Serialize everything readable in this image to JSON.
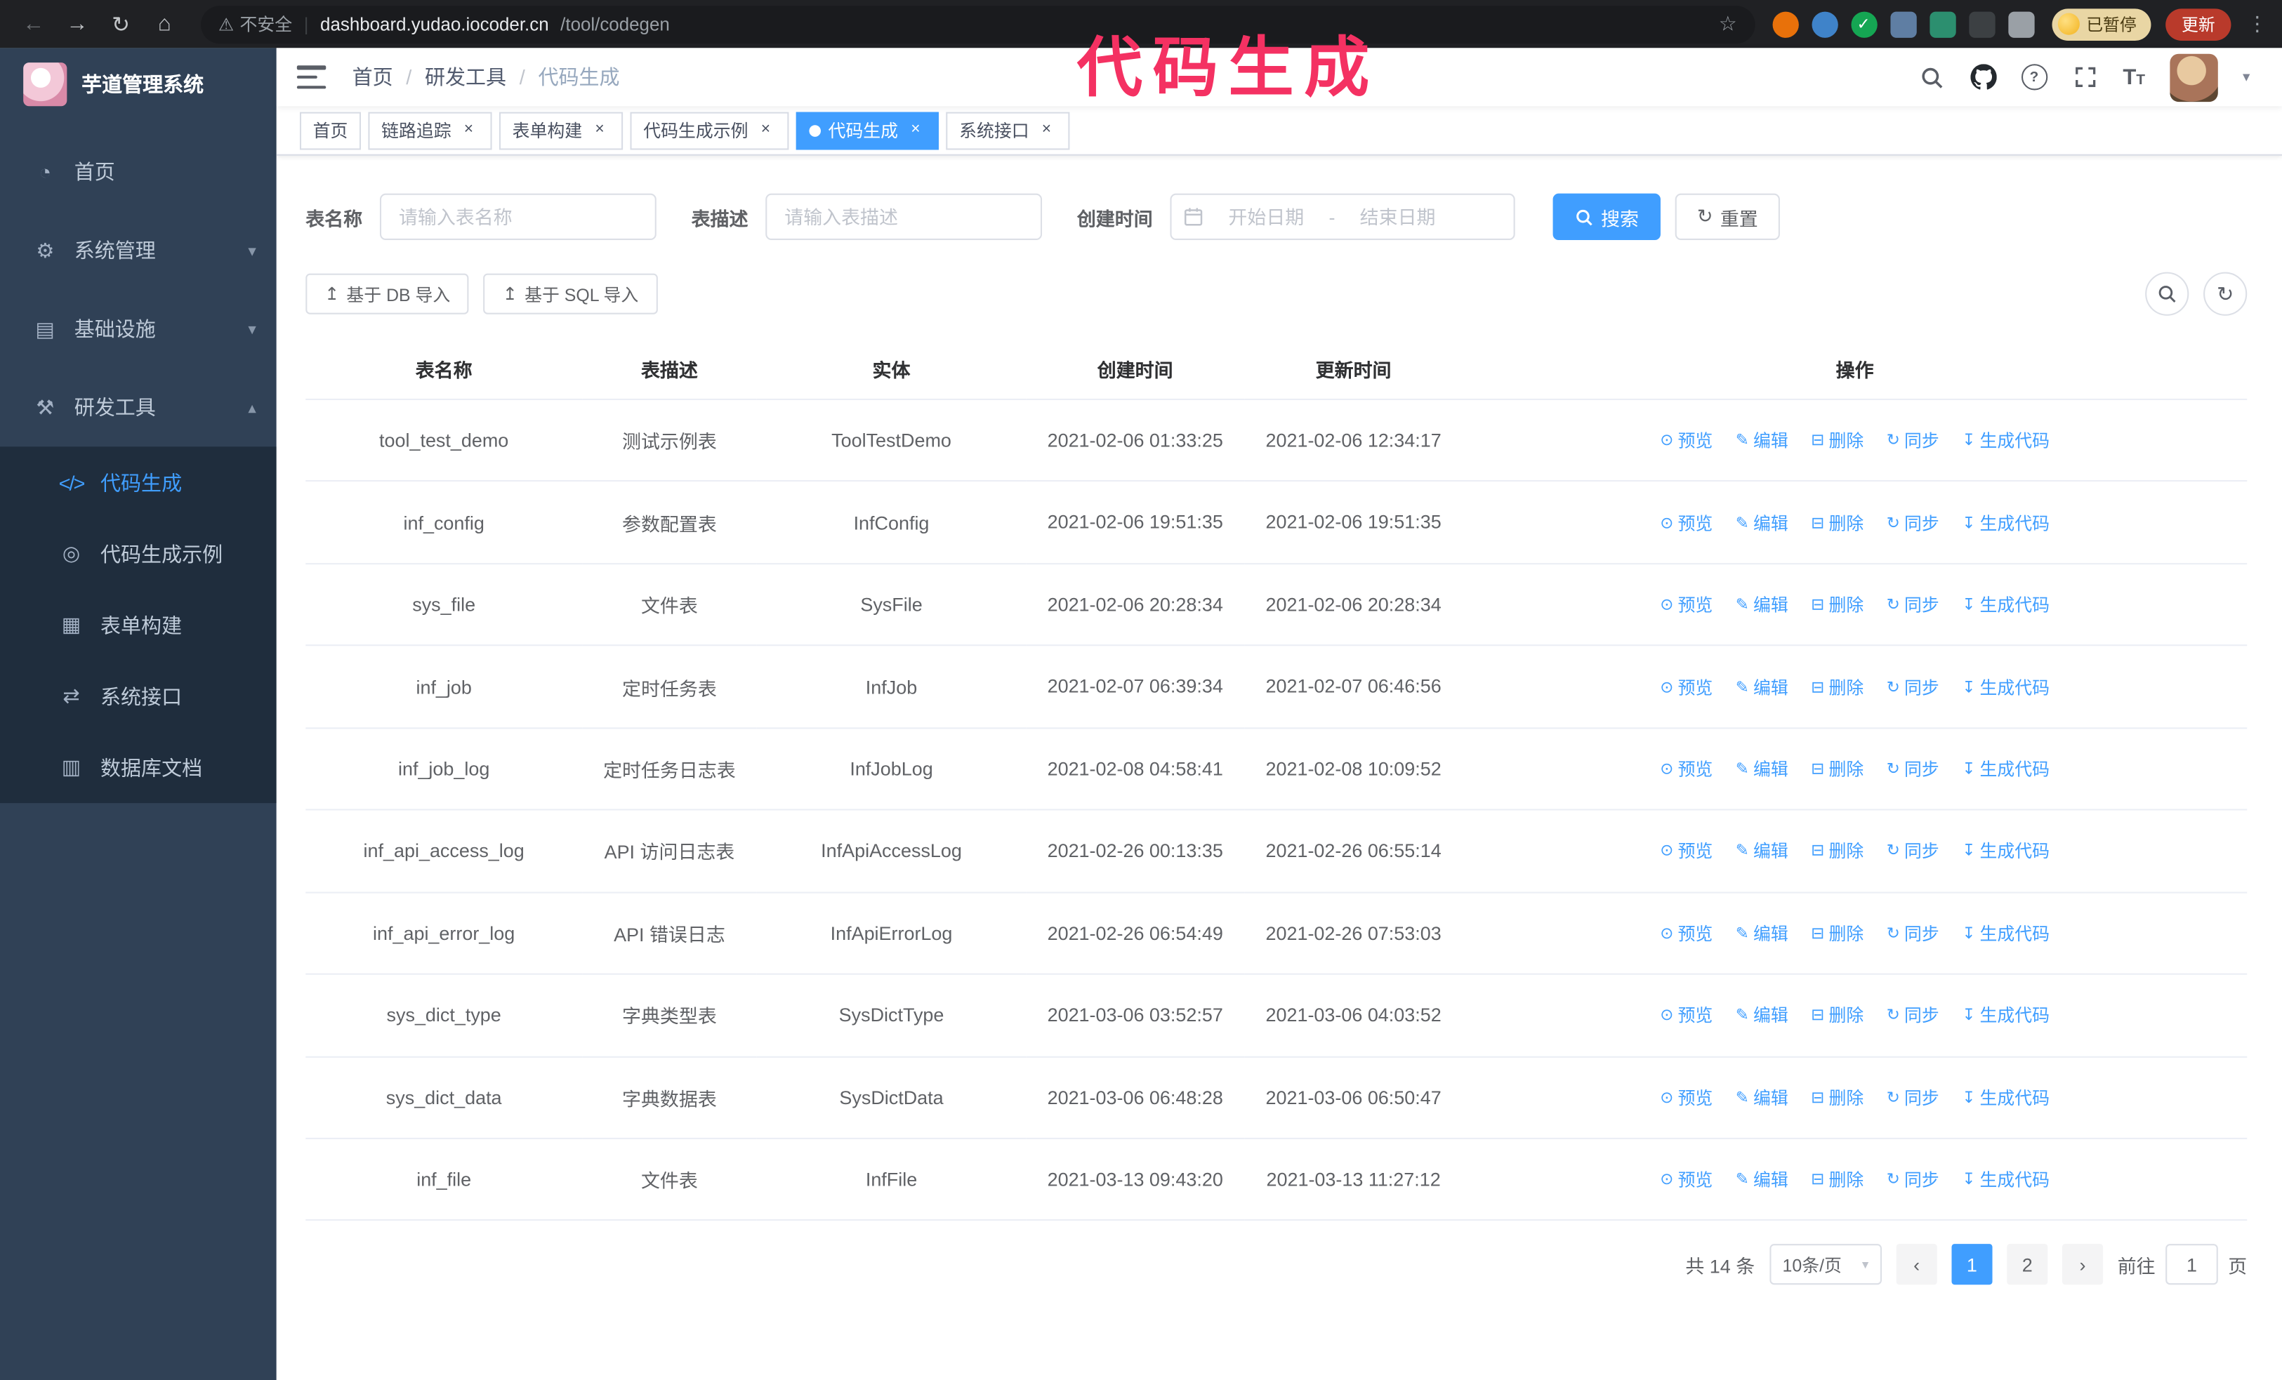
{
  "annotation": "代码生成",
  "colors": {
    "accent": "#409EFF",
    "annotation": "#f43162"
  },
  "browser": {
    "security_label": "不安全",
    "url_host": "dashboard.yudao.iocoder.cn",
    "url_path": "/tool/codegen",
    "paused_badge": "已暂停",
    "update_button": "更新"
  },
  "sidebar": {
    "logo_title": "芋道管理系统",
    "items": [
      {
        "label": "首页"
      },
      {
        "label": "系统管理"
      },
      {
        "label": "基础设施"
      },
      {
        "label": "研发工具"
      }
    ],
    "sub_items": [
      {
        "label": "代码生成"
      },
      {
        "label": "代码生成示例"
      },
      {
        "label": "表单构建"
      },
      {
        "label": "系统接口"
      },
      {
        "label": "数据库文档"
      }
    ]
  },
  "header": {
    "breadcrumb": [
      "首页",
      "研发工具",
      "代码生成"
    ],
    "separator": "/"
  },
  "tabs": [
    {
      "label": "首页"
    },
    {
      "label": "链路追踪"
    },
    {
      "label": "表单构建"
    },
    {
      "label": "代码生成示例"
    },
    {
      "label": "代码生成"
    },
    {
      "label": "系统接口"
    }
  ],
  "filters": {
    "table_name_label": "表名称",
    "table_name_placeholder": "请输入表名称",
    "table_desc_label": "表描述",
    "table_desc_placeholder": "请输入表描述",
    "create_time_label": "创建时间",
    "date_start_placeholder": "开始日期",
    "date_separator": "-",
    "date_end_placeholder": "结束日期",
    "search_button": "搜索",
    "reset_button": "重置"
  },
  "toolbar": {
    "import_db": "基于 DB 导入",
    "import_sql": "基于 SQL 导入"
  },
  "table": {
    "columns": [
      "表名称",
      "表描述",
      "实体",
      "创建时间",
      "更新时间",
      "操作"
    ],
    "actions": [
      "预览",
      "编辑",
      "删除",
      "同步",
      "生成代码"
    ],
    "rows": [
      {
        "name": "tool_test_demo",
        "desc": "测试示例表",
        "entity": "ToolTestDemo",
        "created": "2021-02-06 01:33:25",
        "updated": "2021-02-06 12:34:17"
      },
      {
        "name": "inf_config",
        "desc": "参数配置表",
        "entity": "InfConfig",
        "created": "2021-02-06 19:51:35",
        "updated": "2021-02-06 19:51:35"
      },
      {
        "name": "sys_file",
        "desc": "文件表",
        "entity": "SysFile",
        "created": "2021-02-06 20:28:34",
        "updated": "2021-02-06 20:28:34"
      },
      {
        "name": "inf_job",
        "desc": "定时任务表",
        "entity": "InfJob",
        "created": "2021-02-07 06:39:34",
        "updated": "2021-02-07 06:46:56"
      },
      {
        "name": "inf_job_log",
        "desc": "定时任务日志表",
        "entity": "InfJobLog",
        "created": "2021-02-08 04:58:41",
        "updated": "2021-02-08 10:09:52"
      },
      {
        "name": "inf_api_access_log",
        "desc": "API 访问日志表",
        "entity": "InfApiAccessLog",
        "created": "2021-02-26 00:13:35",
        "updated": "2021-02-26 06:55:14"
      },
      {
        "name": "inf_api_error_log",
        "desc": "API 错误日志",
        "entity": "InfApiErrorLog",
        "created": "2021-02-26 06:54:49",
        "updated": "2021-02-26 07:53:03"
      },
      {
        "name": "sys_dict_type",
        "desc": "字典类型表",
        "entity": "SysDictType",
        "created": "2021-03-06 03:52:57",
        "updated": "2021-03-06 04:03:52"
      },
      {
        "name": "sys_dict_data",
        "desc": "字典数据表",
        "entity": "SysDictData",
        "created": "2021-03-06 06:48:28",
        "updated": "2021-03-06 06:50:47"
      },
      {
        "name": "inf_file",
        "desc": "文件表",
        "entity": "InfFile",
        "created": "2021-03-13 09:43:20",
        "updated": "2021-03-13 11:27:12"
      }
    ]
  },
  "pagination": {
    "total": "共 14 条",
    "page_size": "10条/页",
    "pages": [
      "1",
      "2"
    ],
    "goto_label": "前往",
    "goto_value": "1",
    "goto_suffix": "页"
  },
  "icons": {
    "back": "←",
    "forward": "→",
    "reload": "↻",
    "home": "⌂",
    "warning": "⚠",
    "star": "☆",
    "kebab": "⋮",
    "chevron_down": "▾",
    "chevron_up": "▴",
    "caret_down": "▾",
    "dashboard": "◔",
    "gear": "⚙",
    "infra": "▤",
    "tools": "⚒",
    "code": "</>",
    "example": "◎",
    "form": "▦",
    "api": "⇄",
    "dbdoc": "▥",
    "upload": "↥",
    "eye": "⊙",
    "edit": "✎",
    "delete": "⊟",
    "sync": "↻",
    "download": "↧",
    "check": "✓",
    "close": "×",
    "prev": "‹",
    "next": "›"
  }
}
